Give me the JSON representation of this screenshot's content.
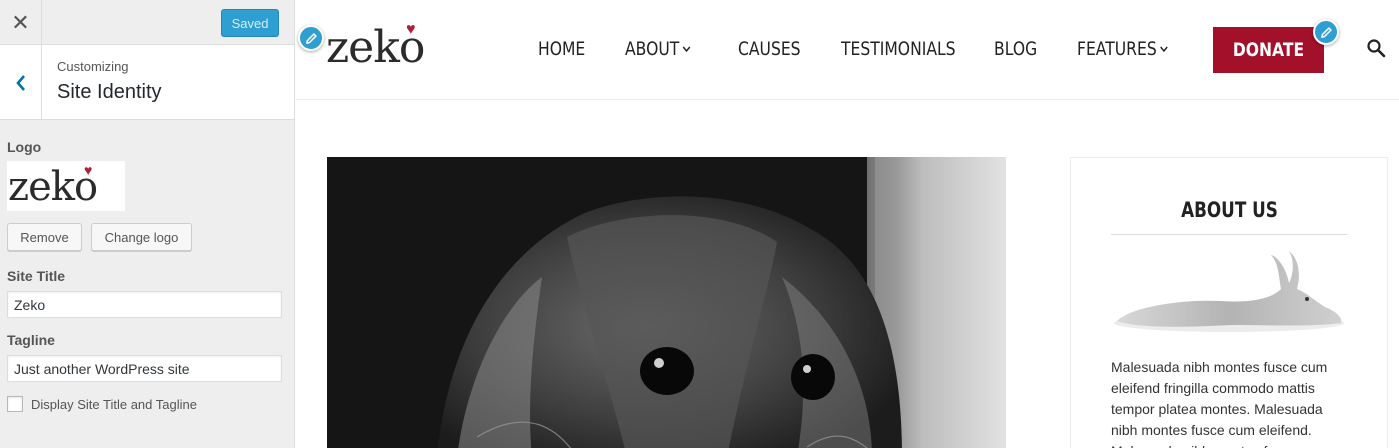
{
  "customizer": {
    "close_glyph": "✕",
    "saved_label": "Saved",
    "customizing_label": "Customizing",
    "section_title": "Site Identity",
    "logo_label": "Logo",
    "remove_label": "Remove",
    "change_logo_label": "Change logo",
    "site_title_label": "Site Title",
    "site_title_value": "Zeko",
    "tagline_label": "Tagline",
    "tagline_value": "Just another WordPress site",
    "display_title_label": "Display Site Title and Tagline",
    "display_title_checked": false
  },
  "site": {
    "logo_text": "zeko",
    "logo_heart": "♥",
    "nav": [
      "HOME",
      "ABOUT",
      "CAUSES",
      "TESTIMONIALS",
      "BLOG",
      "FEATURES"
    ],
    "donate_label": "DONATE",
    "widget": {
      "title": "ABOUT US",
      "text": "Malesuada nibh montes fusce cum eleifend fringilla commodo mattis tempor platea montes. Malesuada nibh montes fusce cum eleifend. Malesuada nibh montes fusce cum"
    }
  },
  "colors": {
    "accent_blue": "#2f9fd2",
    "donate_red": "#a3102a",
    "heart_red": "#b01e37",
    "sidebar_bg": "#eeeeee"
  },
  "icons": [
    "close-icon",
    "back-arrow-icon",
    "pencil-icon",
    "chevron-down-icon",
    "search-icon",
    "heart-icon"
  ]
}
